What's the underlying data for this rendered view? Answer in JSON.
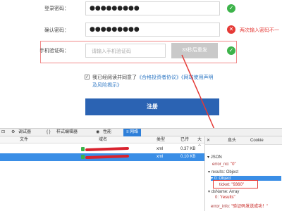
{
  "form": {
    "login_pw_label": "登录密码：",
    "confirm_pw_label": "确认密码：",
    "phone_code_label": "手机验证码：",
    "password_mask": "●●●●●●●●●",
    "confirm_mask": "●●●●●●●●●",
    "confirm_error": "两次输入密码不一",
    "sms_placeholder": "请输入手机验证码",
    "sms_button": "33秒后重发",
    "agree_prefix": "我已经阅读并同意了",
    "agree_link1": "《合格投资者协议》",
    "agree_link2": "《网站使用声明",
    "agree_link3": "及风险揭示》",
    "register_button": "注册",
    "check_mark": "✓",
    "error_mark": "✕"
  },
  "devtools": {
    "tabs": [
      "调试器",
      "样式编辑器",
      "性能",
      "网络"
    ],
    "tab_icons": [
      "bug-icon",
      "braces-icon",
      "gauge-icon",
      "network-icon"
    ],
    "active_tab": "网络",
    "columns": [
      "文件",
      "域名",
      "类型",
      "已传",
      "大小"
    ],
    "rows": [
      {
        "type": "xml",
        "transferred": "0.37 KB"
      },
      {
        "type": "xml",
        "transferred": "0.10 KB"
      }
    ],
    "panel_tabs": [
      "息头",
      "Cookie"
    ],
    "json_tab": "JSON",
    "json_lines": {
      "l1_key": "error_no:",
      "l1_val": "\"0\"",
      "l2": "results: Object",
      "l3": "0: Object",
      "l4_key": "ticket:",
      "l4_val": "\"9360\"",
      "l5": "dsName: Array",
      "l6_key": "0:",
      "l6_val": "\"results\"",
      "l7_key": "error_info:",
      "l7_val": "\"验证码发送成功！\""
    }
  },
  "colors": {
    "primary": "#2b63b3",
    "success": "#3db34a",
    "error": "#e53935",
    "devtools_active": "#3a8ee6"
  }
}
